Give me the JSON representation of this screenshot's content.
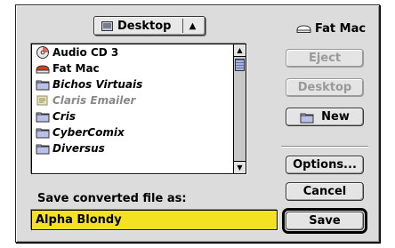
{
  "folder_popup": {
    "label": "Desktop",
    "icon": "folder-stack-icon"
  },
  "files": [
    {
      "name": "Audio CD 3",
      "icon": "cd-icon",
      "style": "normal"
    },
    {
      "name": "Fat Mac",
      "icon": "hard-disk-icon",
      "style": "normal"
    },
    {
      "name": "Bichos Virtuais",
      "icon": "folder-icon",
      "style": "alias"
    },
    {
      "name": "Claris Emailer",
      "icon": "app-icon",
      "style": "dimmed-alias"
    },
    {
      "name": "Cris",
      "icon": "folder-icon",
      "style": "alias"
    },
    {
      "name": "CyberComix",
      "icon": "folder-icon",
      "style": "alias"
    },
    {
      "name": "Diversus",
      "icon": "folder-icon",
      "style": "alias"
    }
  ],
  "volume": {
    "name": "Fat Mac",
    "icon": "hard-disk-icon"
  },
  "buttons": {
    "eject": "Eject",
    "desktop": "Desktop",
    "new": "New",
    "options": "Options...",
    "cancel": "Cancel",
    "save": "Save"
  },
  "save_prompt": "Save converted file as:",
  "filename": "Alpha Blondy",
  "colors": {
    "field_highlight": "#f4e222",
    "disk_red": "#d04020",
    "dialog_bg": "#dcdcdc"
  }
}
